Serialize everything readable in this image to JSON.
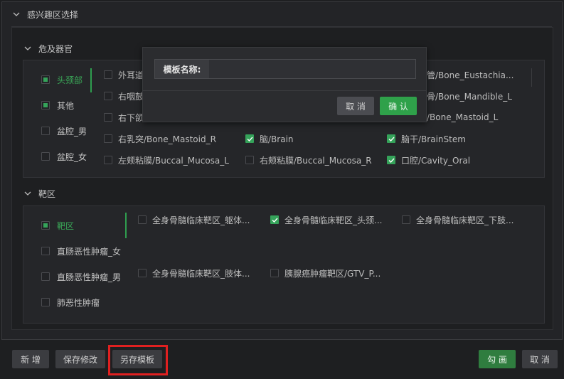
{
  "roi": {
    "title": "感兴趣区选择"
  },
  "organs": {
    "title": "危及器官",
    "side": [
      {
        "label": "头颈部",
        "state": "partial",
        "active": true
      },
      {
        "label": "其他",
        "state": "partial",
        "active": false
      },
      {
        "label": "盆腔_男",
        "state": "none",
        "active": false
      },
      {
        "label": "盆腔_女",
        "state": "none",
        "active": false
      }
    ],
    "options": [
      {
        "label": "外耳道",
        "checked": false
      },
      {
        "label": "右咽鼓",
        "checked": false
      },
      {
        "label": "右下颌",
        "checked": false
      },
      {
        "label": "右乳突/Bone_Mastoid_R",
        "checked": false
      },
      {
        "label": "左颊粘膜/Buccal_Mucosa_L",
        "checked": false
      },
      {
        "label": "脑/Brain",
        "checked": true
      },
      {
        "label": "右颊粘膜/Buccal_Mucosa_R",
        "checked": false
      },
      {
        "label": "管/Bone_Eustachia...",
        "checked": false
      },
      {
        "label": "骨/Bone_Mandible_L",
        "checked": false
      },
      {
        "label": "/Bone_Mastoid_L",
        "checked": false
      },
      {
        "label": "脑干/BrainStem",
        "checked": true
      },
      {
        "label": "口腔/Cavity_Oral",
        "checked": true
      }
    ]
  },
  "target": {
    "title": "靶区",
    "side": [
      {
        "label": "靶区",
        "state": "partial",
        "active": true
      },
      {
        "label": "直肠恶性肿瘤_女",
        "state": "none",
        "active": false
      },
      {
        "label": "直肠恶性肿瘤_男",
        "state": "none",
        "active": false
      },
      {
        "label": "肺恶性肿瘤",
        "state": "none",
        "active": false
      }
    ],
    "options": [
      {
        "label": "全身骨髓临床靶区_躯体...",
        "checked": false
      },
      {
        "label": "全身骨髓临床靶区_头颈...",
        "checked": true
      },
      {
        "label": "全身骨髓临床靶区_下肢...",
        "checked": false
      },
      {
        "label": "全身骨髓临床靶区_肢体...",
        "checked": false
      },
      {
        "label": "胰腺癌肿瘤靶区/GTV_P...",
        "checked": false
      }
    ]
  },
  "modal": {
    "label": "模板名称:",
    "value": "",
    "cancel": "取 消",
    "confirm": "确 认"
  },
  "footer": {
    "add": "新 增",
    "save": "保存修改",
    "save_as": "另存模板",
    "draw": "勾 画",
    "cancel": "取 消"
  },
  "colors": {
    "accent": "#35a35a",
    "highlight": "#e02020"
  }
}
